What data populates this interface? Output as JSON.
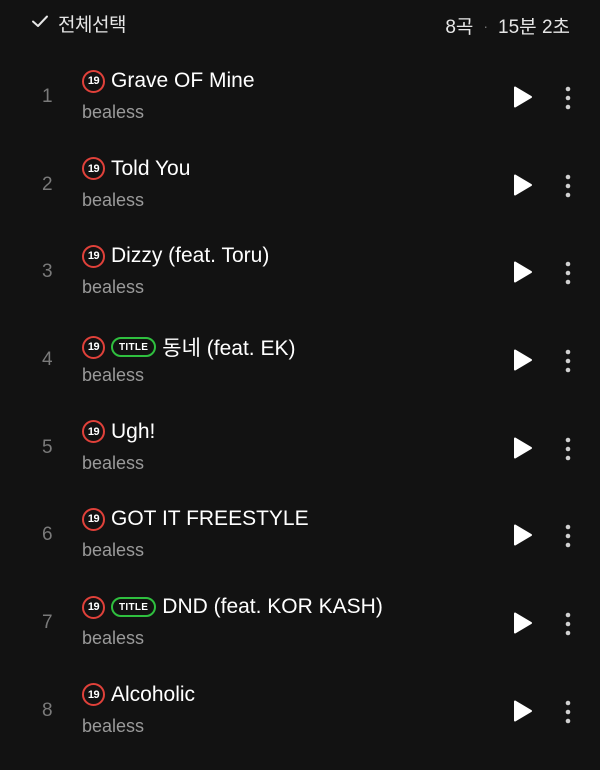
{
  "header": {
    "select_all_label": "전체선택",
    "count": "8곡",
    "separator": "·",
    "duration": "15분 2초"
  },
  "badges": {
    "age": "19",
    "title": "TITLE"
  },
  "colors": {
    "background": "#121212",
    "age_badge": "#e0413a",
    "title_badge": "#2fbf3f",
    "artist_text": "#9a9a9a",
    "track_number": "#7a7a7a"
  },
  "tracks": [
    {
      "num": "1",
      "title": "Grave OF Mine",
      "artist": "bealess",
      "is_title": false
    },
    {
      "num": "2",
      "title": "Told You",
      "artist": "bealess",
      "is_title": false
    },
    {
      "num": "3",
      "title": "Dizzy (feat. Toru)",
      "artist": "bealess",
      "is_title": false
    },
    {
      "num": "4",
      "title": "동네 (feat. EK)",
      "artist": "bealess",
      "is_title": true
    },
    {
      "num": "5",
      "title": "Ugh!",
      "artist": "bealess",
      "is_title": false
    },
    {
      "num": "6",
      "title": "GOT IT FREESTYLE",
      "artist": "bealess",
      "is_title": false
    },
    {
      "num": "7",
      "title": "DND (feat. KOR KASH)",
      "artist": "bealess",
      "is_title": true
    },
    {
      "num": "8",
      "title": "Alcoholic",
      "artist": "bealess",
      "is_title": false
    }
  ],
  "icons": {
    "select_all": "check-icon",
    "play": "play-icon",
    "more": "more-vertical-icon"
  }
}
